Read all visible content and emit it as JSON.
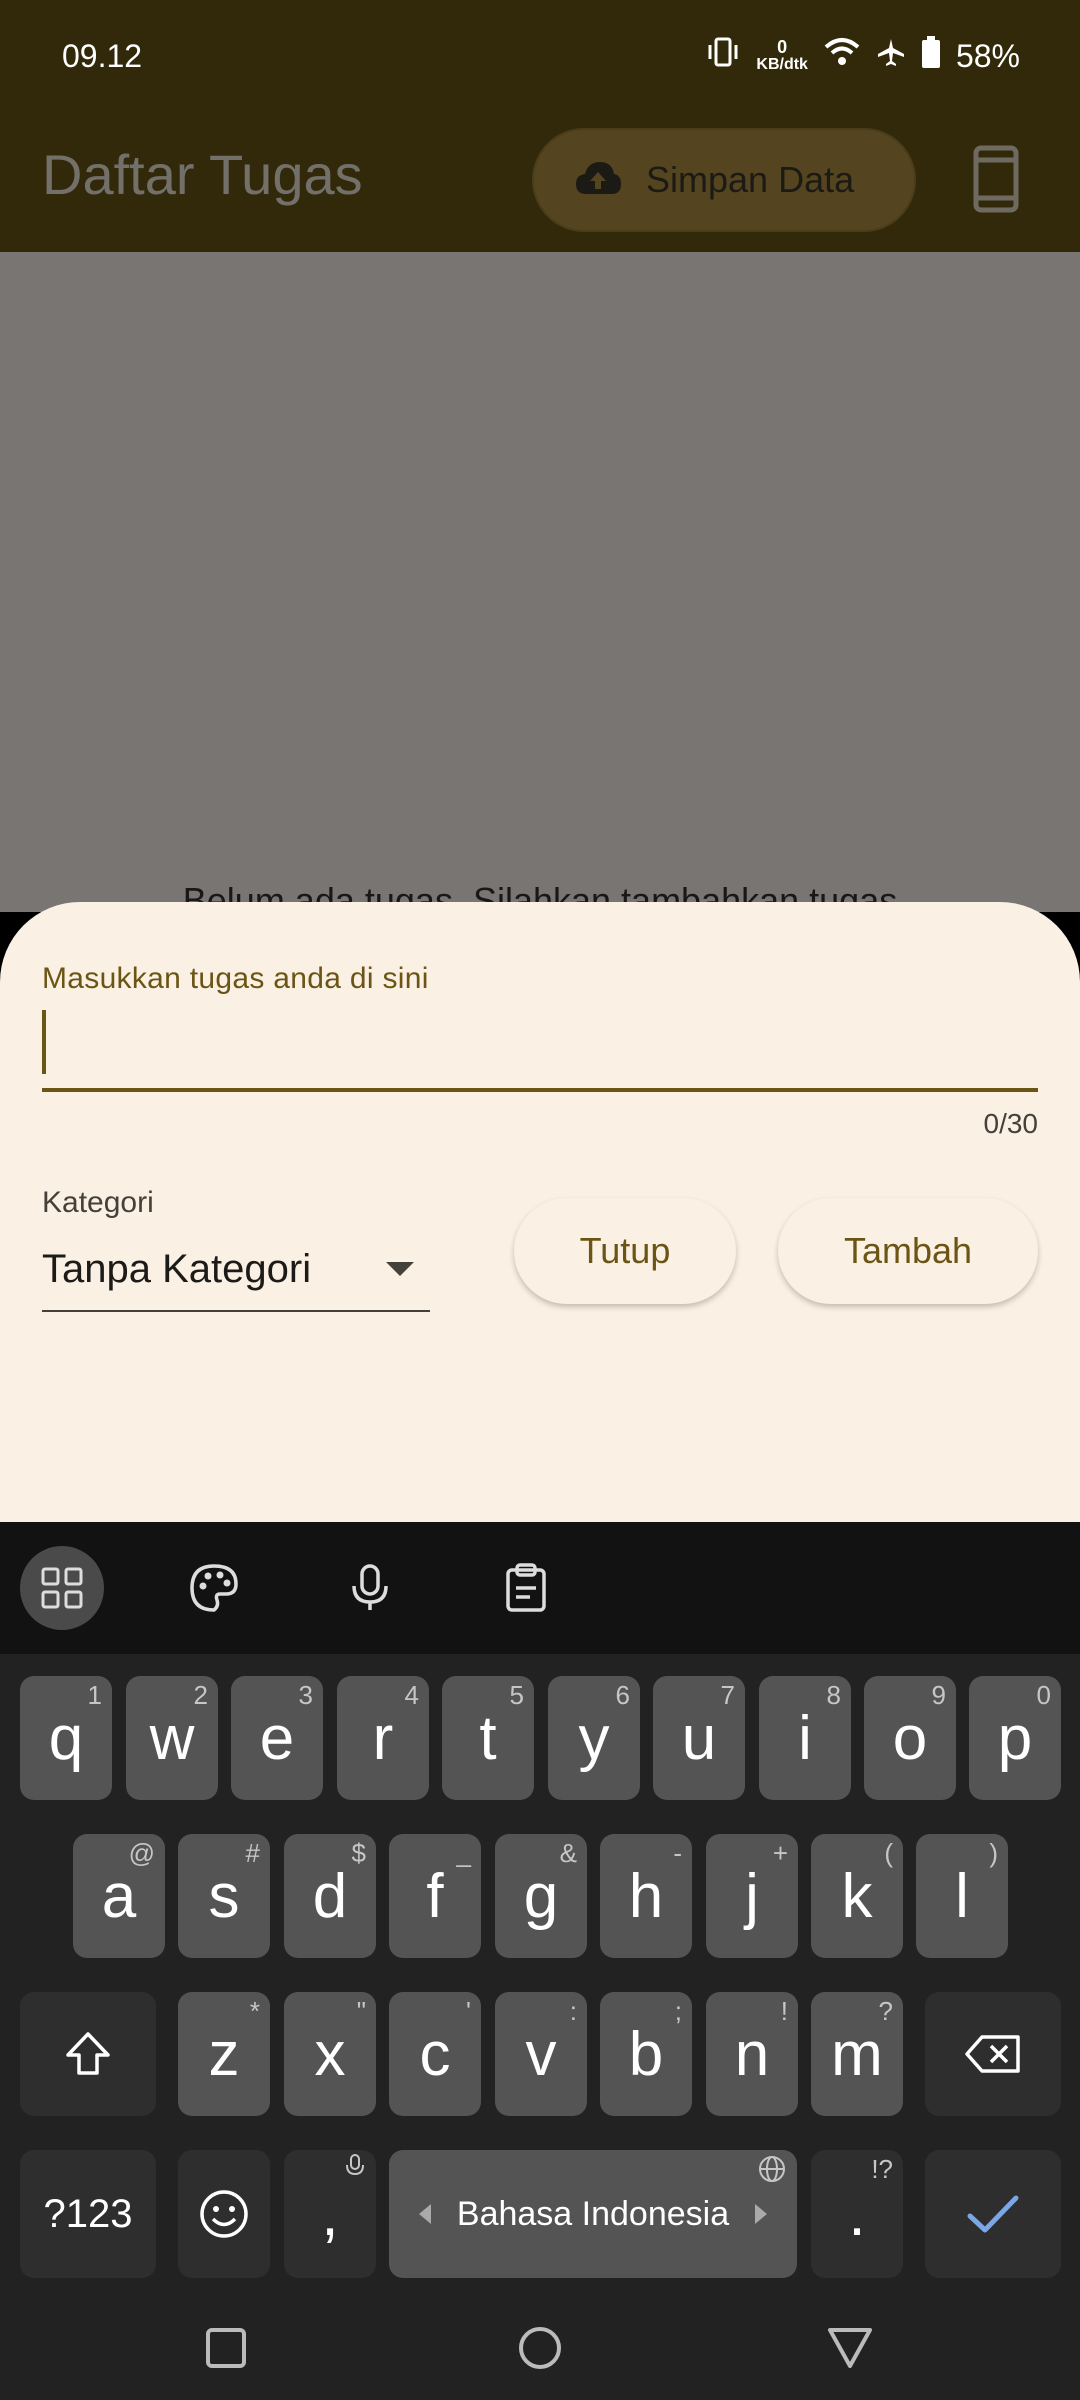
{
  "status_bar": {
    "time": "09.12",
    "net_speed_value": "0",
    "net_speed_unit": "KB/dtk",
    "battery": "58%"
  },
  "app_bar": {
    "title": "Daftar Tugas",
    "save_label": "Simpan Data"
  },
  "main": {
    "empty_message": "Belum ada tugas. Silahkan tambahkan tugas"
  },
  "sheet": {
    "input_label": "Masukkan tugas anda di sini",
    "input_value": "",
    "counter": "0/30",
    "category_label": "Kategori",
    "category_value": "Tanpa Kategori",
    "close_label": "Tutup",
    "add_label": "Tambah"
  },
  "keyboard": {
    "row1": [
      [
        "q",
        "1"
      ],
      [
        "w",
        "2"
      ],
      [
        "e",
        "3"
      ],
      [
        "r",
        "4"
      ],
      [
        "t",
        "5"
      ],
      [
        "y",
        "6"
      ],
      [
        "u",
        "7"
      ],
      [
        "i",
        "8"
      ],
      [
        "o",
        "9"
      ],
      [
        "p",
        "0"
      ]
    ],
    "row2": [
      [
        "a",
        "@"
      ],
      [
        "s",
        "#"
      ],
      [
        "d",
        "$"
      ],
      [
        "f",
        "_"
      ],
      [
        "g",
        "&"
      ],
      [
        "h",
        "-"
      ],
      [
        "j",
        "+"
      ],
      [
        "k",
        "("
      ],
      [
        "l",
        ")"
      ]
    ],
    "row3": [
      [
        "z",
        "*"
      ],
      [
        "x",
        "\""
      ],
      [
        "c",
        "'"
      ],
      [
        "v",
        ":"
      ],
      [
        "b",
        ";"
      ],
      [
        "n",
        "!"
      ],
      [
        "m",
        "?"
      ]
    ],
    "symbols_label": "?123",
    "comma": ",",
    "period": ".",
    "period_hint": "!?",
    "space_label": "Bahasa Indonesia"
  },
  "colors": {
    "accent": "#6b5514",
    "sheet_bg": "#fbf0e4",
    "appbar_bg": "#32290b"
  }
}
